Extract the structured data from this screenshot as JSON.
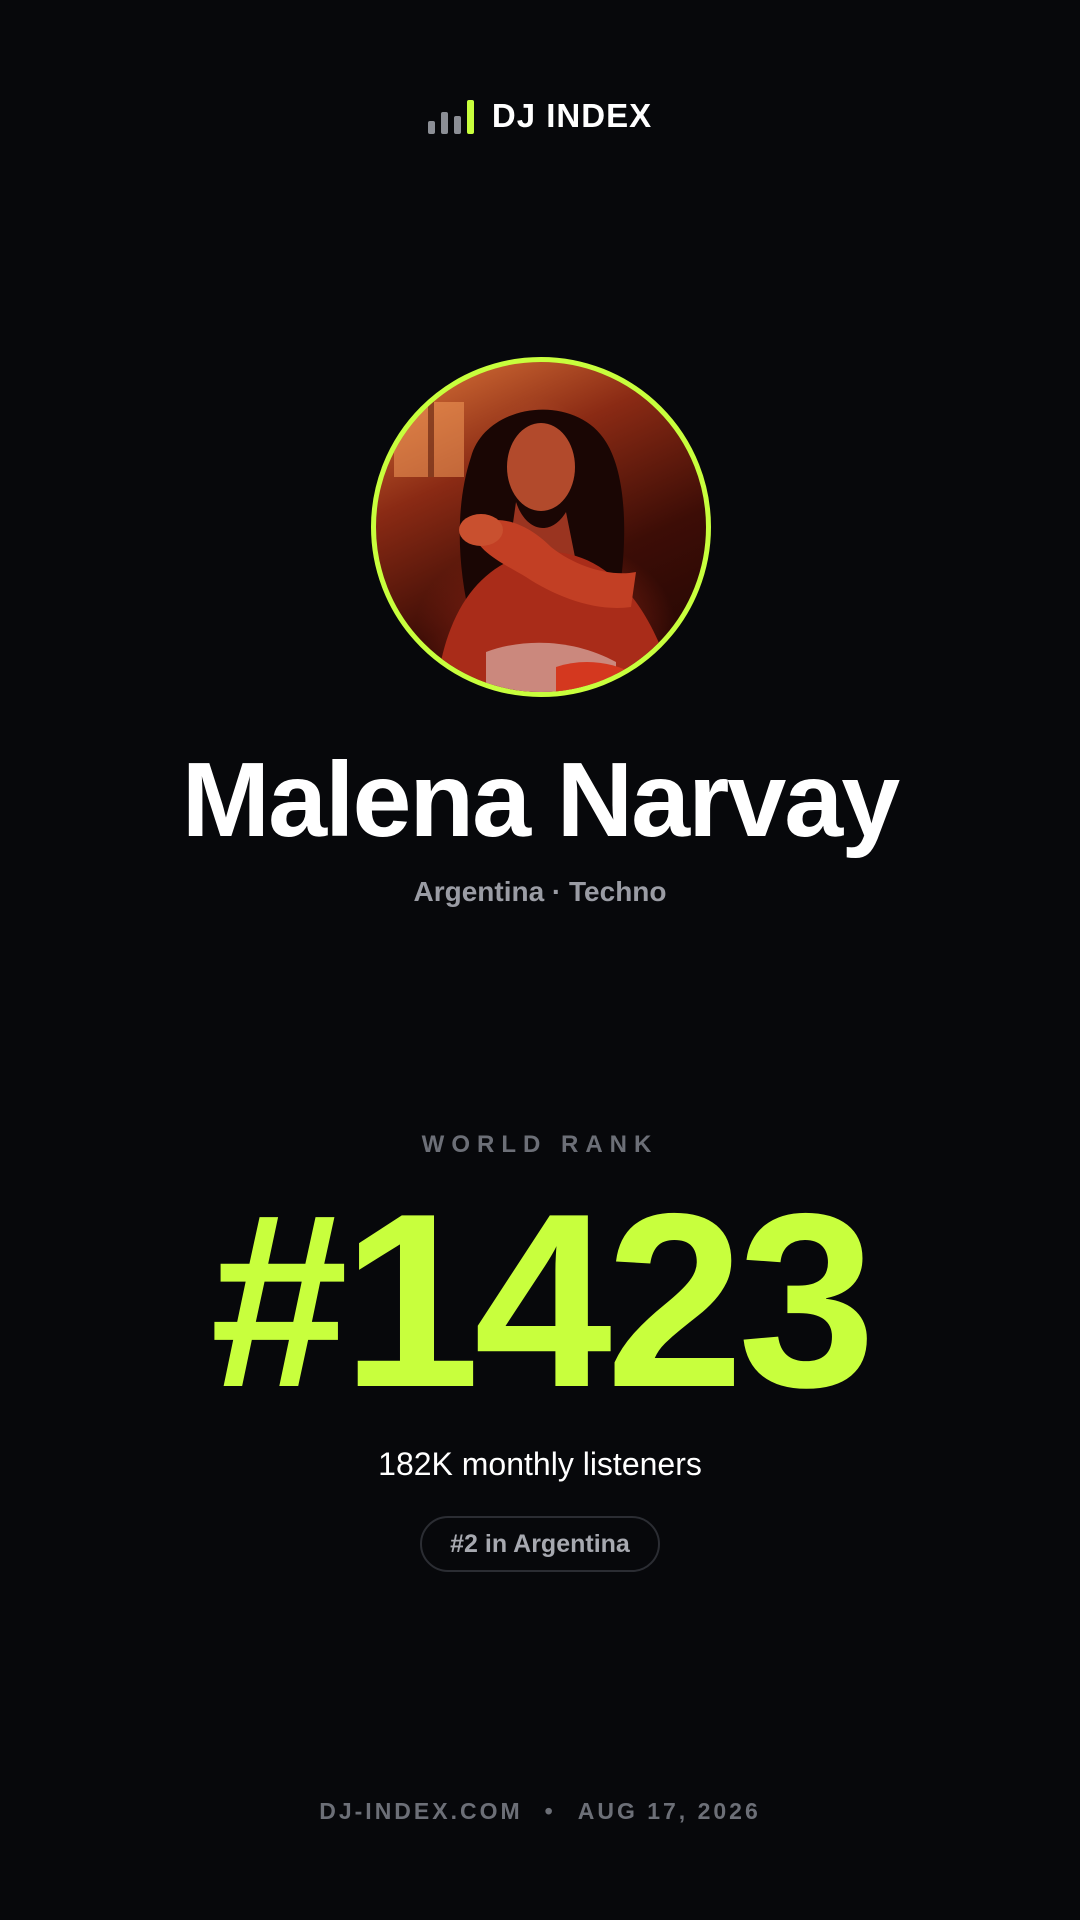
{
  "brand": {
    "name": "DJ INDEX",
    "accent_color": "#c8ff3d",
    "icon": "bar-chart-icon"
  },
  "artist": {
    "name": "Malena Narvay",
    "meta": "Argentina · Techno",
    "avatar_icon": "artist-photo"
  },
  "rank": {
    "label": "WORLD RANK",
    "value": "#1423",
    "listeners": "182K monthly listeners",
    "country_rank": "#2 in Argentina"
  },
  "footer": {
    "site": "DJ-INDEX.COM",
    "separator": "•",
    "date": "AUG 17, 2026"
  }
}
